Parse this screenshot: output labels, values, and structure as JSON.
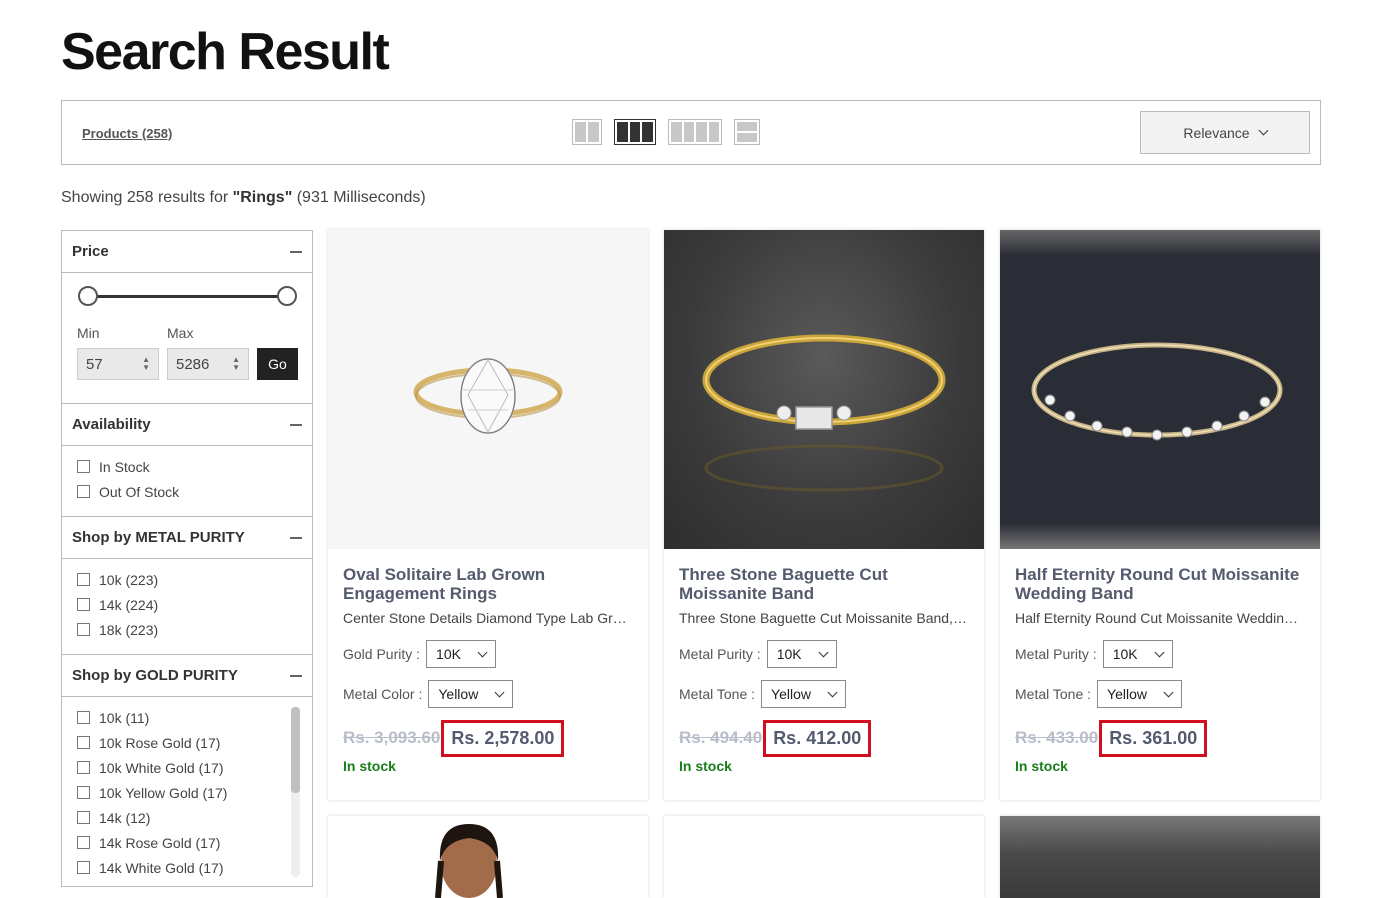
{
  "page": {
    "title": "Search Result"
  },
  "toolbar": {
    "products_label": "Products (258)",
    "view_modes": [
      "two-column-view-icon",
      "three-column-view-icon",
      "four-column-view-icon",
      "list-view-icon"
    ],
    "active_view": "three-column",
    "sort_label": "Relevance"
  },
  "results": {
    "prefix": "Showing 258 results for ",
    "query": "\"Rings\"",
    "suffix": " (931 Milliseconds)"
  },
  "filters": {
    "price": {
      "title": "Price",
      "min_label": "Min",
      "max_label": "Max",
      "min_value": "57",
      "max_value": "5286",
      "go_label": "Go"
    },
    "availability": {
      "title": "Availability",
      "items": [
        "In Stock",
        "Out Of Stock"
      ]
    },
    "metal_purity": {
      "title": "Shop by METAL PURITY",
      "items": [
        "10k (223)",
        "14k (224)",
        "18k (223)"
      ]
    },
    "gold_purity": {
      "title": "Shop by GOLD PURITY",
      "items": [
        "10k (11)",
        "10k Rose Gold (17)",
        "10k White Gold (17)",
        "10k Yellow Gold (17)",
        "14k (12)",
        "14k Rose Gold (17)",
        "14k White Gold (17)"
      ]
    }
  },
  "products": [
    {
      "title": "Oval Solitaire Lab Grown Engagement Rings",
      "desc": "Center Stone Details Diamond Type Lab Grown Diamond",
      "opt1_label": "Gold Purity :",
      "opt1_value": "10K",
      "opt2_label": "Metal Color :",
      "opt2_value": "Yellow",
      "old_price": "Rs. 3,093.60",
      "price": "Rs. 2,578.00",
      "stock": "In stock"
    },
    {
      "title": "Three Stone Baguette Cut Moissanite Band",
      "desc": "Three Stone Baguette Cut Moissanite Band, Minimalist",
      "opt1_label": "Metal Purity :",
      "opt1_value": "10K",
      "opt2_label": "Metal Tone :",
      "opt2_value": "Yellow",
      "old_price": "Rs. 494.40",
      "price": "Rs. 412.00",
      "stock": "In stock"
    },
    {
      "title": "Half Eternity Round Cut Moissanite Wedding Band",
      "desc": "Half Eternity Round Cut Moissanite Wedding Band",
      "opt1_label": "Metal Purity :",
      "opt1_value": "10K",
      "opt2_label": "Metal Tone :",
      "opt2_value": "Yellow",
      "old_price": "Rs. 433.00",
      "price": "Rs. 361.00",
      "stock": "In stock"
    }
  ],
  "colors": {
    "highlight": "#d0101e",
    "in_stock": "#1a7d1a",
    "title": "#555b6e"
  }
}
